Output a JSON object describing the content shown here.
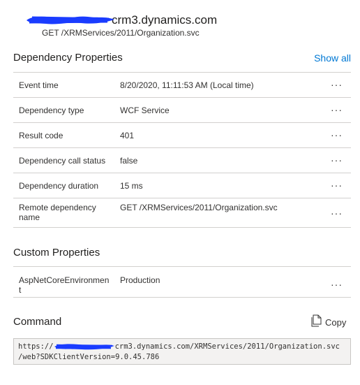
{
  "header": {
    "host": "crm3.dynamics.com",
    "request": "GET /XRMServices/2011/Organization.svc"
  },
  "dependency": {
    "title": "Dependency Properties",
    "show_all": "Show all",
    "rows": [
      {
        "key": "Event time",
        "value": "8/20/2020, 11:11:53 AM (Local time)"
      },
      {
        "key": "Dependency type",
        "value": "WCF Service"
      },
      {
        "key": "Result code",
        "value": "401"
      },
      {
        "key": "Dependency call status",
        "value": "false"
      },
      {
        "key": "Dependency duration",
        "value": "15 ms"
      },
      {
        "key": "Remote dependency name",
        "value": "GET /XRMServices/2011/Organization.svc"
      }
    ]
  },
  "custom": {
    "title": "Custom Properties",
    "rows": [
      {
        "key": "AspNetCoreEnvironment",
        "value": "Production"
      }
    ]
  },
  "command": {
    "title": "Command",
    "copy_label": "Copy",
    "line1_prefix": "https://",
    "line1_suffix": "crm3.dynamics.com/XRMServices/2011/Organization.svc",
    "line2": "/web?SDKClientVersion=9.0.45.786"
  },
  "more_glyph": "···",
  "colors": {
    "accent": "#0078d4",
    "redaction": "#1a3cff"
  },
  "icons": {
    "more": "more-icon",
    "copy": "copy-icon"
  }
}
